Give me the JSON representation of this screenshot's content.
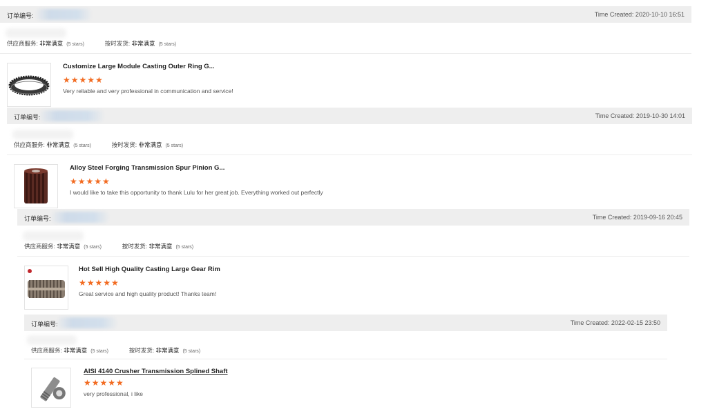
{
  "reviews": [
    {
      "order_label": "订单编号:",
      "time_created": "Time Created: 2020-10-10 16:51",
      "supplier_service_label": "供应商服务:",
      "supplier_service_value": "非常满意",
      "supplier_service_stars": "(5 stars)",
      "ontime_label": "按时发货:",
      "ontime_value": "非常满意",
      "ontime_stars": "(5 stars)",
      "product_title": "Customize Large Module Casting Outer Ring G...",
      "rating": "★★★★★",
      "comment": "Very reliable and very professional in communication and service!",
      "thumb_icon": "ring-gear-icon"
    },
    {
      "order_label": "订单编号:",
      "time_created": "Time Created: 2019-10-30 14:01",
      "supplier_service_label": "供应商服务:",
      "supplier_service_value": "非常满意",
      "supplier_service_stars": "(5 stars)",
      "ontime_label": "按时发货:",
      "ontime_value": "非常满意",
      "ontime_stars": "(5 stars)",
      "product_title": "Alloy Steel Forging Transmission Spur Pinion G...",
      "rating": "★★★★★",
      "comment": "I would like to take this opportunity to thank Lulu for her great job. Everything worked out perfectly",
      "thumb_icon": "spur-pinion-icon"
    },
    {
      "order_label": "订单编号:",
      "time_created": "Time Created: 2019-09-16 20:45",
      "supplier_service_label": "供应商服务:",
      "supplier_service_value": "非常满意",
      "supplier_service_stars": "(5 stars)",
      "ontime_label": "按时发货:",
      "ontime_value": "非常满意",
      "ontime_stars": "(5 stars)",
      "product_title": "Hot Sell High Quality Casting Large Gear Rim",
      "rating": "★★★★★",
      "comment": "Great service and high quality product! Thanks team!",
      "thumb_icon": "gear-rim-icon"
    },
    {
      "order_label": "订单编号:",
      "time_created": "Time Created: 2022-02-15 23:50",
      "supplier_service_label": "供应商服务:",
      "supplier_service_value": "非常满意",
      "supplier_service_stars": "(5 stars)",
      "ontime_label": "按时发货:",
      "ontime_value": "非常满意",
      "ontime_stars": "(5 stars)",
      "product_title": "AISI 4140 Crusher Transmission Splined Shaft",
      "rating": "★★★★★",
      "comment": "very professional, i like",
      "thumb_icon": "splined-shaft-icon"
    }
  ],
  "colors": {
    "star": "#f26b21",
    "header_bg": "#eeeeee"
  }
}
